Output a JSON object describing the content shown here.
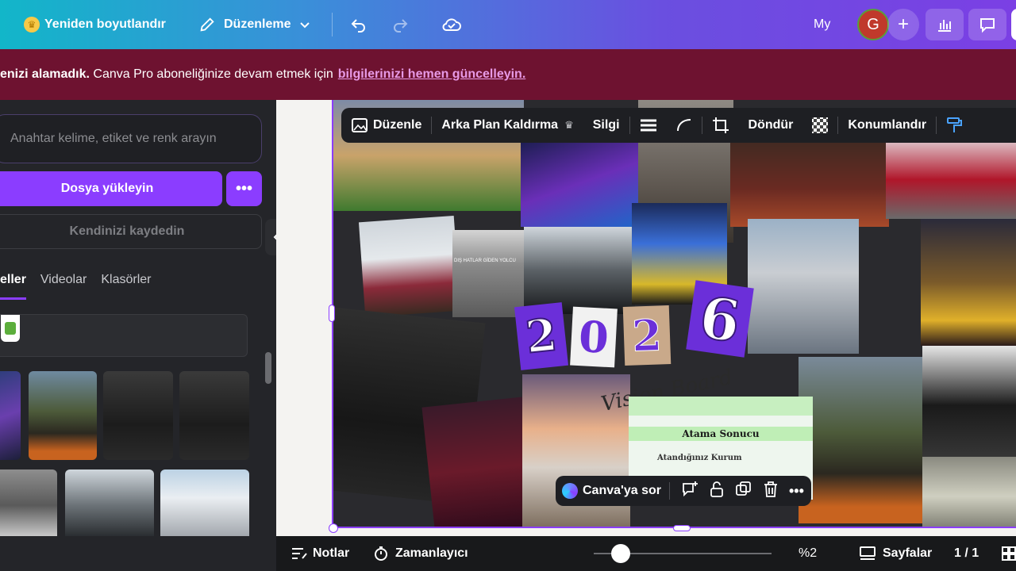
{
  "topbar": {
    "resize_label": "Yeniden boyutlandır",
    "edit_label": "Düzenleme",
    "my_label": "My",
    "avatar_letter": "G"
  },
  "banner": {
    "bold_text": "enizi alamadık.",
    "text": "Canva Pro aboneliğinize devam etmek için",
    "link": "bilgilerinizi hemen güncelleyin."
  },
  "sidebar": {
    "search_placeholder": "Anahtar kelime, etiket ve renk arayın",
    "upload_label": "Dosya yükleyin",
    "more_label": "•••",
    "record_label": "Kendinizi kaydedin",
    "tabs": [
      "eller",
      "Videolar",
      "Klasörler"
    ]
  },
  "context_toolbar": {
    "edit": "Düzenle",
    "bg_remove": "Arka Plan Kaldırma",
    "delete": "Silgi",
    "rotate": "Döndür",
    "position": "Konumlandır"
  },
  "canvas": {
    "year_digits": [
      "2",
      "0",
      "2",
      "6"
    ],
    "script_text": "Vision Board",
    "result_title": "Atama Sonucu",
    "result_row": "Atandığınız Kurum",
    "passport_text": "DIŞ HATLAR GİDEN YOLCU"
  },
  "ask_bar": {
    "label": "Canva'ya sor"
  },
  "bottombar": {
    "notes": "Notlar",
    "timer": "Zamanlayıcı",
    "zoom": "%2",
    "pages": "Sayfalar",
    "page_count": "1 / 1"
  },
  "colors": {
    "accent": "#8b3dff",
    "banner": "#6e1230",
    "link": "#e79ae6"
  }
}
